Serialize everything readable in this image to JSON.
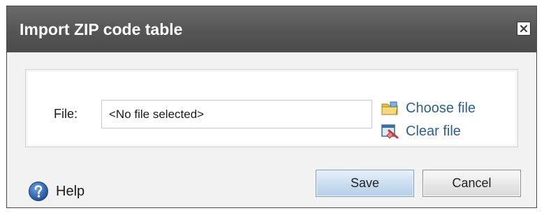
{
  "dialog": {
    "title": "Import ZIP code table",
    "close_icon": "close-icon"
  },
  "file": {
    "label": "File:",
    "value": "<No file selected>",
    "choose_label": "Choose file",
    "choose_icon": "folder-open-icon",
    "clear_label": "Clear file",
    "clear_icon": "clear-file-icon"
  },
  "footer": {
    "help_label": "Help",
    "help_icon": "help-icon",
    "save_label": "Save",
    "cancel_label": "Cancel"
  },
  "colors": {
    "titlebar": "#555555",
    "link": "#2d5f91",
    "save_button": "#c9dcef"
  }
}
